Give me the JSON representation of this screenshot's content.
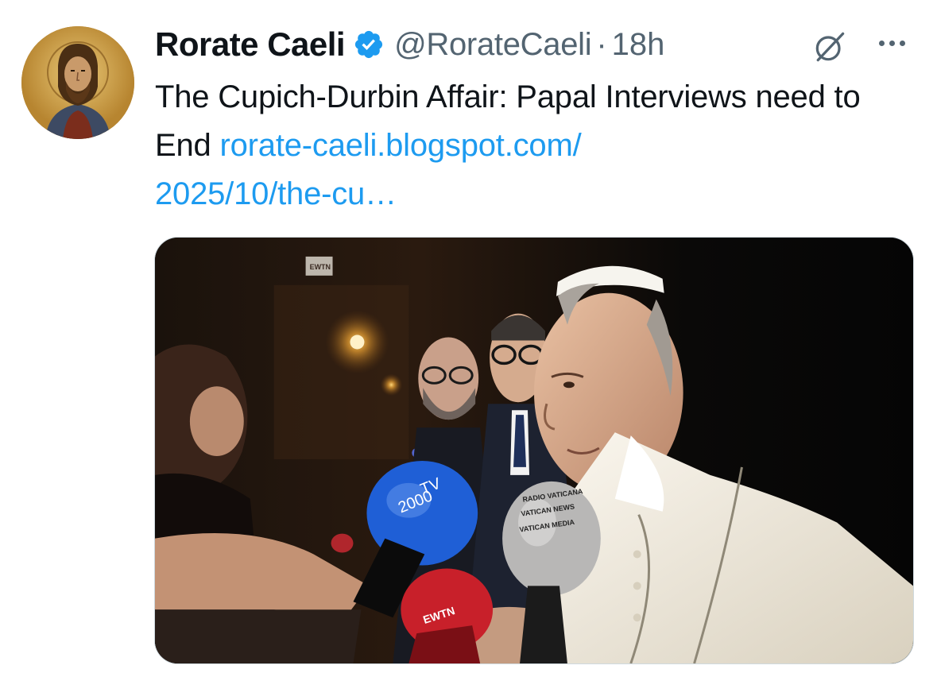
{
  "tweet": {
    "author_name": "Rorate Caeli",
    "handle": "@RorateCaeli",
    "separator": "·",
    "time": "18h",
    "text": "The Cupich-Durbin Affair: Papal Interviews need to End",
    "link_line1": "rorate-caeli.blogspot.com/",
    "link_line2": "2025/10/the-cu…"
  },
  "icons": {
    "verified": "verified-badge-icon",
    "grok": "grok-icon",
    "more": "more-options-icon"
  },
  "media": {
    "mic_labels": {
      "tv2000_top": "TV",
      "tv2000_bottom": "2000",
      "radio": "RADIO VATICANA",
      "news": "VATICAN NEWS",
      "media": "VATICAN MEDIA",
      "ewtn": "EWTN",
      "ewtn_sign": "EWTN"
    }
  },
  "colors": {
    "text": "#0f1419",
    "secondary": "#536471",
    "link": "#1d9bf0",
    "verified": "#1d9bf0",
    "tv2000_mic": "#1f5fd6",
    "ewtn_mic": "#c8202a"
  }
}
